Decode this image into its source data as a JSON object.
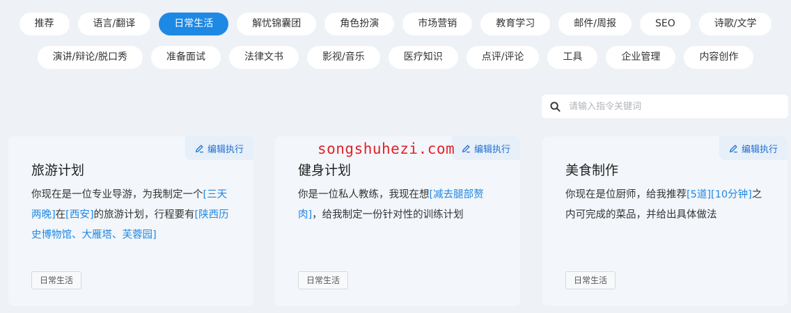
{
  "categories": {
    "row1": [
      "推荐",
      "语言/翻译",
      "日常生活",
      "解忧锦囊团",
      "角色扮演",
      "市场营销",
      "教育学习",
      "邮件/周报",
      "SEO",
      "诗歌/文学"
    ],
    "row2": [
      "演讲/辩论/脱口秀",
      "准备面试",
      "法律文书",
      "影视/音乐",
      "医疗知识",
      "点评/评论",
      "工具",
      "企业管理",
      "内容创作"
    ],
    "active": "日常生活"
  },
  "search": {
    "placeholder": "请输入指令关键词",
    "value": ""
  },
  "edit_label": "编辑执行",
  "watermark": "songshuhezi.com",
  "cards": [
    {
      "title": "旅游计划",
      "desc": [
        {
          "t": "你现在是一位专业导游，为我制定一个"
        },
        {
          "t": "[三天两晚]",
          "hl": true
        },
        {
          "t": "在"
        },
        {
          "t": "[西安]",
          "hl": true
        },
        {
          "t": "的旅游计划，行程要有"
        },
        {
          "t": "[陕西历史博物馆、大雁塔、芙蓉园]",
          "hl": true
        }
      ],
      "tag": "日常生活"
    },
    {
      "title": "健身计划",
      "desc": [
        {
          "t": "你是一位私人教练，我现在想"
        },
        {
          "t": "[减去腿部赘肉]",
          "hl": true
        },
        {
          "t": "，给我制定一份针对性的训练计划"
        }
      ],
      "tag": "日常生活"
    },
    {
      "title": "美食制作",
      "desc": [
        {
          "t": "你现在是位厨师，给我推荐"
        },
        {
          "t": "[5道]",
          "hl": true
        },
        {
          "t": "[10分钟]",
          "hl": true
        },
        {
          "t": "之内可完成的菜品，并给出具体做法"
        }
      ],
      "tag": "日常生活"
    }
  ],
  "colors": {
    "accent": "#1e88e5",
    "background": "#eef1f6",
    "watermark": "#e0232a"
  },
  "icons": {
    "search": "search-icon",
    "edit": "pencil-icon"
  }
}
